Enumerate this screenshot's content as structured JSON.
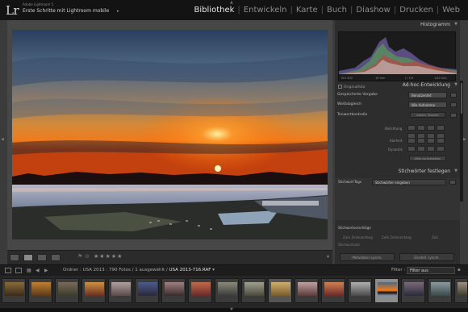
{
  "app": {
    "logo": "Lr",
    "name": "Adobe Lightroom 5",
    "catalog": "Erste Schritte mit Lightroom mobile",
    "catalog_arrow": "▸"
  },
  "modules": [
    {
      "label": "Bibliothek",
      "active": true
    },
    {
      "label": "Entwickeln",
      "active": false
    },
    {
      "label": "Karte",
      "active": false
    },
    {
      "label": "Buch",
      "active": false
    },
    {
      "label": "Diashow",
      "active": false
    },
    {
      "label": "Drucken",
      "active": false
    },
    {
      "label": "Web",
      "active": false
    }
  ],
  "right_panel": {
    "histogram": {
      "title": "Histogramm",
      "labels": [
        "ISO 400",
        "16 mm",
        "ƒ / 5.6",
        "1/40 Sek."
      ],
      "original_label": "Originalfoto"
    },
    "quick_develop": {
      "title": "Ad-hoc-Entwicklung",
      "preset_label": "Gespeicherte Vorgabe",
      "preset_value": "Benutzerdef.",
      "wb_label": "Weißabgleich",
      "wb_value": "Wie Aufnahme",
      "tone_label": "Tonwertkontrolle",
      "tone_auto": "Autom. Tonwert",
      "exposure_label": "Belichtung",
      "clarity_label": "Klarheit",
      "vibrance_label": "Dynamik",
      "reset_label": "Alles zurücksetzen"
    },
    "keywording": {
      "title": "Stichwörter festlegen",
      "tags_label": "Stichwort-Tags",
      "tags_placeholder": "Stichwörter eingeben",
      "suggestions_label": "Stichwortvorschläge",
      "suggestions": [
        "Zum Zeilenanfang",
        "Zeilt Zeilenanfang",
        "Zeit"
      ],
      "set_label": "Stichwortsatz"
    },
    "buttons": {
      "sync": "Metadaten synchr.",
      "settings": "Einstell. synchr."
    }
  },
  "filmstrip_bar": {
    "folder_prefix": "Ordner : USA 2013 : 790 Fotos / 1 ausgewählt /",
    "selected_file": "USA 2013-716.RAF",
    "arrow": "▾",
    "filter_label": "Filter :",
    "filter_value": "Filter aus"
  },
  "toolbar": {
    "stars": "★★★★★"
  },
  "colors": {
    "accent": "#e8e8e8",
    "panel": "#2d2d2d",
    "background": "#3b3b3b"
  }
}
